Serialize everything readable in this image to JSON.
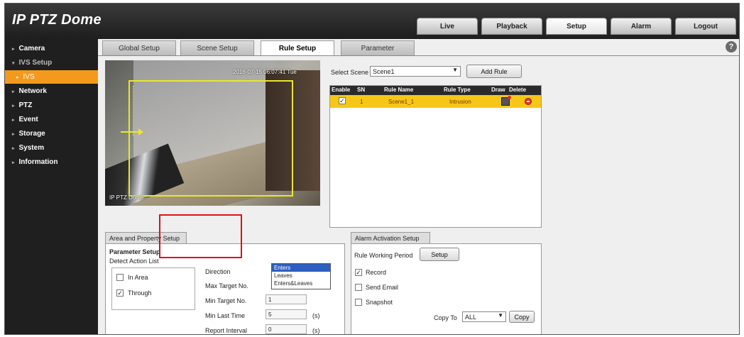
{
  "app": {
    "title": "IP PTZ Dome"
  },
  "topnav": [
    {
      "label": "Live",
      "active": false
    },
    {
      "label": "Playback",
      "active": false
    },
    {
      "label": "Setup",
      "active": true
    },
    {
      "label": "Alarm",
      "active": false
    },
    {
      "label": "Logout",
      "active": false
    }
  ],
  "sidebar": {
    "items": [
      {
        "label": "Camera"
      },
      {
        "label": "IVS Setup",
        "expanded": true
      },
      {
        "label": "IVS",
        "selected": true
      },
      {
        "label": "Network"
      },
      {
        "label": "PTZ"
      },
      {
        "label": "Event"
      },
      {
        "label": "Storage"
      },
      {
        "label": "System"
      },
      {
        "label": "Information"
      }
    ]
  },
  "tabs": [
    {
      "label": "Global Setup"
    },
    {
      "label": "Scene Setup"
    },
    {
      "label": "Rule Setup",
      "active": true
    },
    {
      "label": "Parameter"
    }
  ],
  "help_label": "?",
  "video": {
    "timestamp": "2016-07-15 06:07:41 Tue",
    "camera_name": "IP PTZ Dome"
  },
  "scene": {
    "label": "Select Scene",
    "selected": "Scene1",
    "add_rule_label": "Add Rule"
  },
  "rules_table": {
    "columns": [
      "Enable",
      "SN",
      "Rule Name",
      "Rule Type",
      "Draw",
      "Delete"
    ],
    "rows": [
      {
        "enabled": true,
        "sn": "1",
        "name": "Scene1_1",
        "type": "Intrusion",
        "draw_icon": "draw-icon",
        "delete_icon": "delete-icon"
      }
    ]
  },
  "area_setup": {
    "tab_label": "Area and Property Setup",
    "section_title": "Parameter Setup",
    "detect_action_label": "Detect Action List",
    "actions": [
      {
        "label": "In Area",
        "checked": false
      },
      {
        "label": "Through",
        "checked": true
      }
    ],
    "direction_label": "Direction",
    "direction_options": [
      "Enters",
      "Leaves",
      "Enters&Leaves"
    ],
    "direction_selected": "Enters",
    "max_target_label": "Max Target No.",
    "min_target_label": "Min Target No.",
    "min_target_value": "1",
    "min_last_time_label": "Min Last Time",
    "min_last_time_value": "5",
    "min_last_time_unit": "(s)",
    "report_interval_label": "Report Interval",
    "report_interval_value": "0",
    "report_interval_unit": "(s)"
  },
  "alarm_setup": {
    "tab_label": "Alarm Activation Setup",
    "working_period_label": "Rule Working Period",
    "setup_button_label": "Setup",
    "options": [
      {
        "label": "Record",
        "checked": true
      },
      {
        "label": "Send Email",
        "checked": false
      },
      {
        "label": "Snapshot",
        "checked": false
      }
    ],
    "copy_to_label": "Copy To",
    "copy_to_value": "ALL",
    "copy_button_label": "Copy"
  },
  "colors": {
    "accent_orange": "#f39a1c",
    "rule_row_yellow": "#f6c718",
    "highlight_red": "#e0101a",
    "roi_yellow": "#e8e82a"
  }
}
